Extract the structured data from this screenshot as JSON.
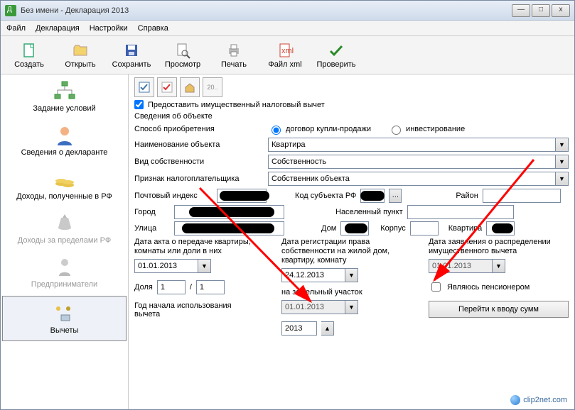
{
  "window": {
    "title": "Без имени - Декларация 2013"
  },
  "menu": {
    "file": "Файл",
    "decl": "Декларация",
    "settings": "Настройки",
    "help": "Справка"
  },
  "toolbar": {
    "create": "Создать",
    "open": "Открыть",
    "save": "Сохранить",
    "preview": "Просмотр",
    "print": "Печать",
    "xml": "Файл xml",
    "check": "Проверить"
  },
  "sidebar": {
    "items": [
      "Задание условий",
      "Сведения о декларанте",
      "Доходы, полученные в РФ",
      "Доходы за пределами РФ",
      "Предприниматели",
      "Вычеты"
    ]
  },
  "content": {
    "provide_deduction": "Предоставить имущественный налоговый вычет",
    "object_info": "Сведения об объекте",
    "acq_method": "Способ приобретения",
    "radio_buy": "договор купли-продажи",
    "radio_invest": "инвестирование",
    "object_name": "Наименование объекта",
    "object_name_val": "Квартира",
    "ownership_type": "Вид собственности",
    "ownership_type_val": "Собственность",
    "taxpayer_sign": "Признак налогоплательщика",
    "taxpayer_sign_val": "Собственник объекта",
    "postal": "Почтовый индекс",
    "subject_code": "Код субъекта РФ",
    "district": "Район",
    "city": "Город",
    "locality": "Населенный пункт",
    "street": "Улица",
    "house": "Дом",
    "building": "Корпус",
    "apartment": "Квартира",
    "date_act": "Дата акта о передаче квартиры, комнаты или доли в них",
    "date_reg": "Дата регистрации права собственности на жилой дом, квартиру, комнату",
    "date_land": "на земельный участок",
    "date_decl": "Дата заявления о распределении имущественного вычета",
    "date_act_val": "01.01.2013",
    "date_reg_val": "24.12.2013",
    "date_land_val": "01.01.2013",
    "date_decl_val": "01.01.2013",
    "share": "Доля",
    "share_num": "1",
    "share_den": "1",
    "year_use": "Год начала использования вычета",
    "year_use_val": "2013",
    "pensioner": "Являюсь пенсионером",
    "goto_sums": "Перейти к вводу сумм"
  },
  "watermark": "clip2net.com"
}
